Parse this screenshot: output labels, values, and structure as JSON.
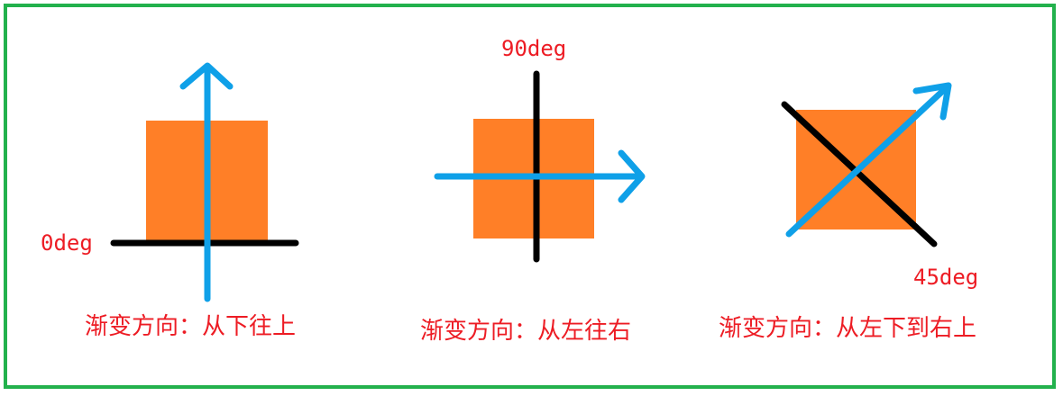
{
  "colors": {
    "border": "#22b14c",
    "square": "#ff7f27",
    "arrow": "#0fa0e8",
    "axis": "#000000",
    "text": "#ed1c24"
  },
  "panels": [
    {
      "angle_label": "0deg",
      "caption": "渐变方向：从下往上"
    },
    {
      "angle_label": "90deg",
      "caption": "渐变方向：从左往右"
    },
    {
      "angle_label": "45deg",
      "caption": "渐变方向：从左下到右上"
    }
  ]
}
